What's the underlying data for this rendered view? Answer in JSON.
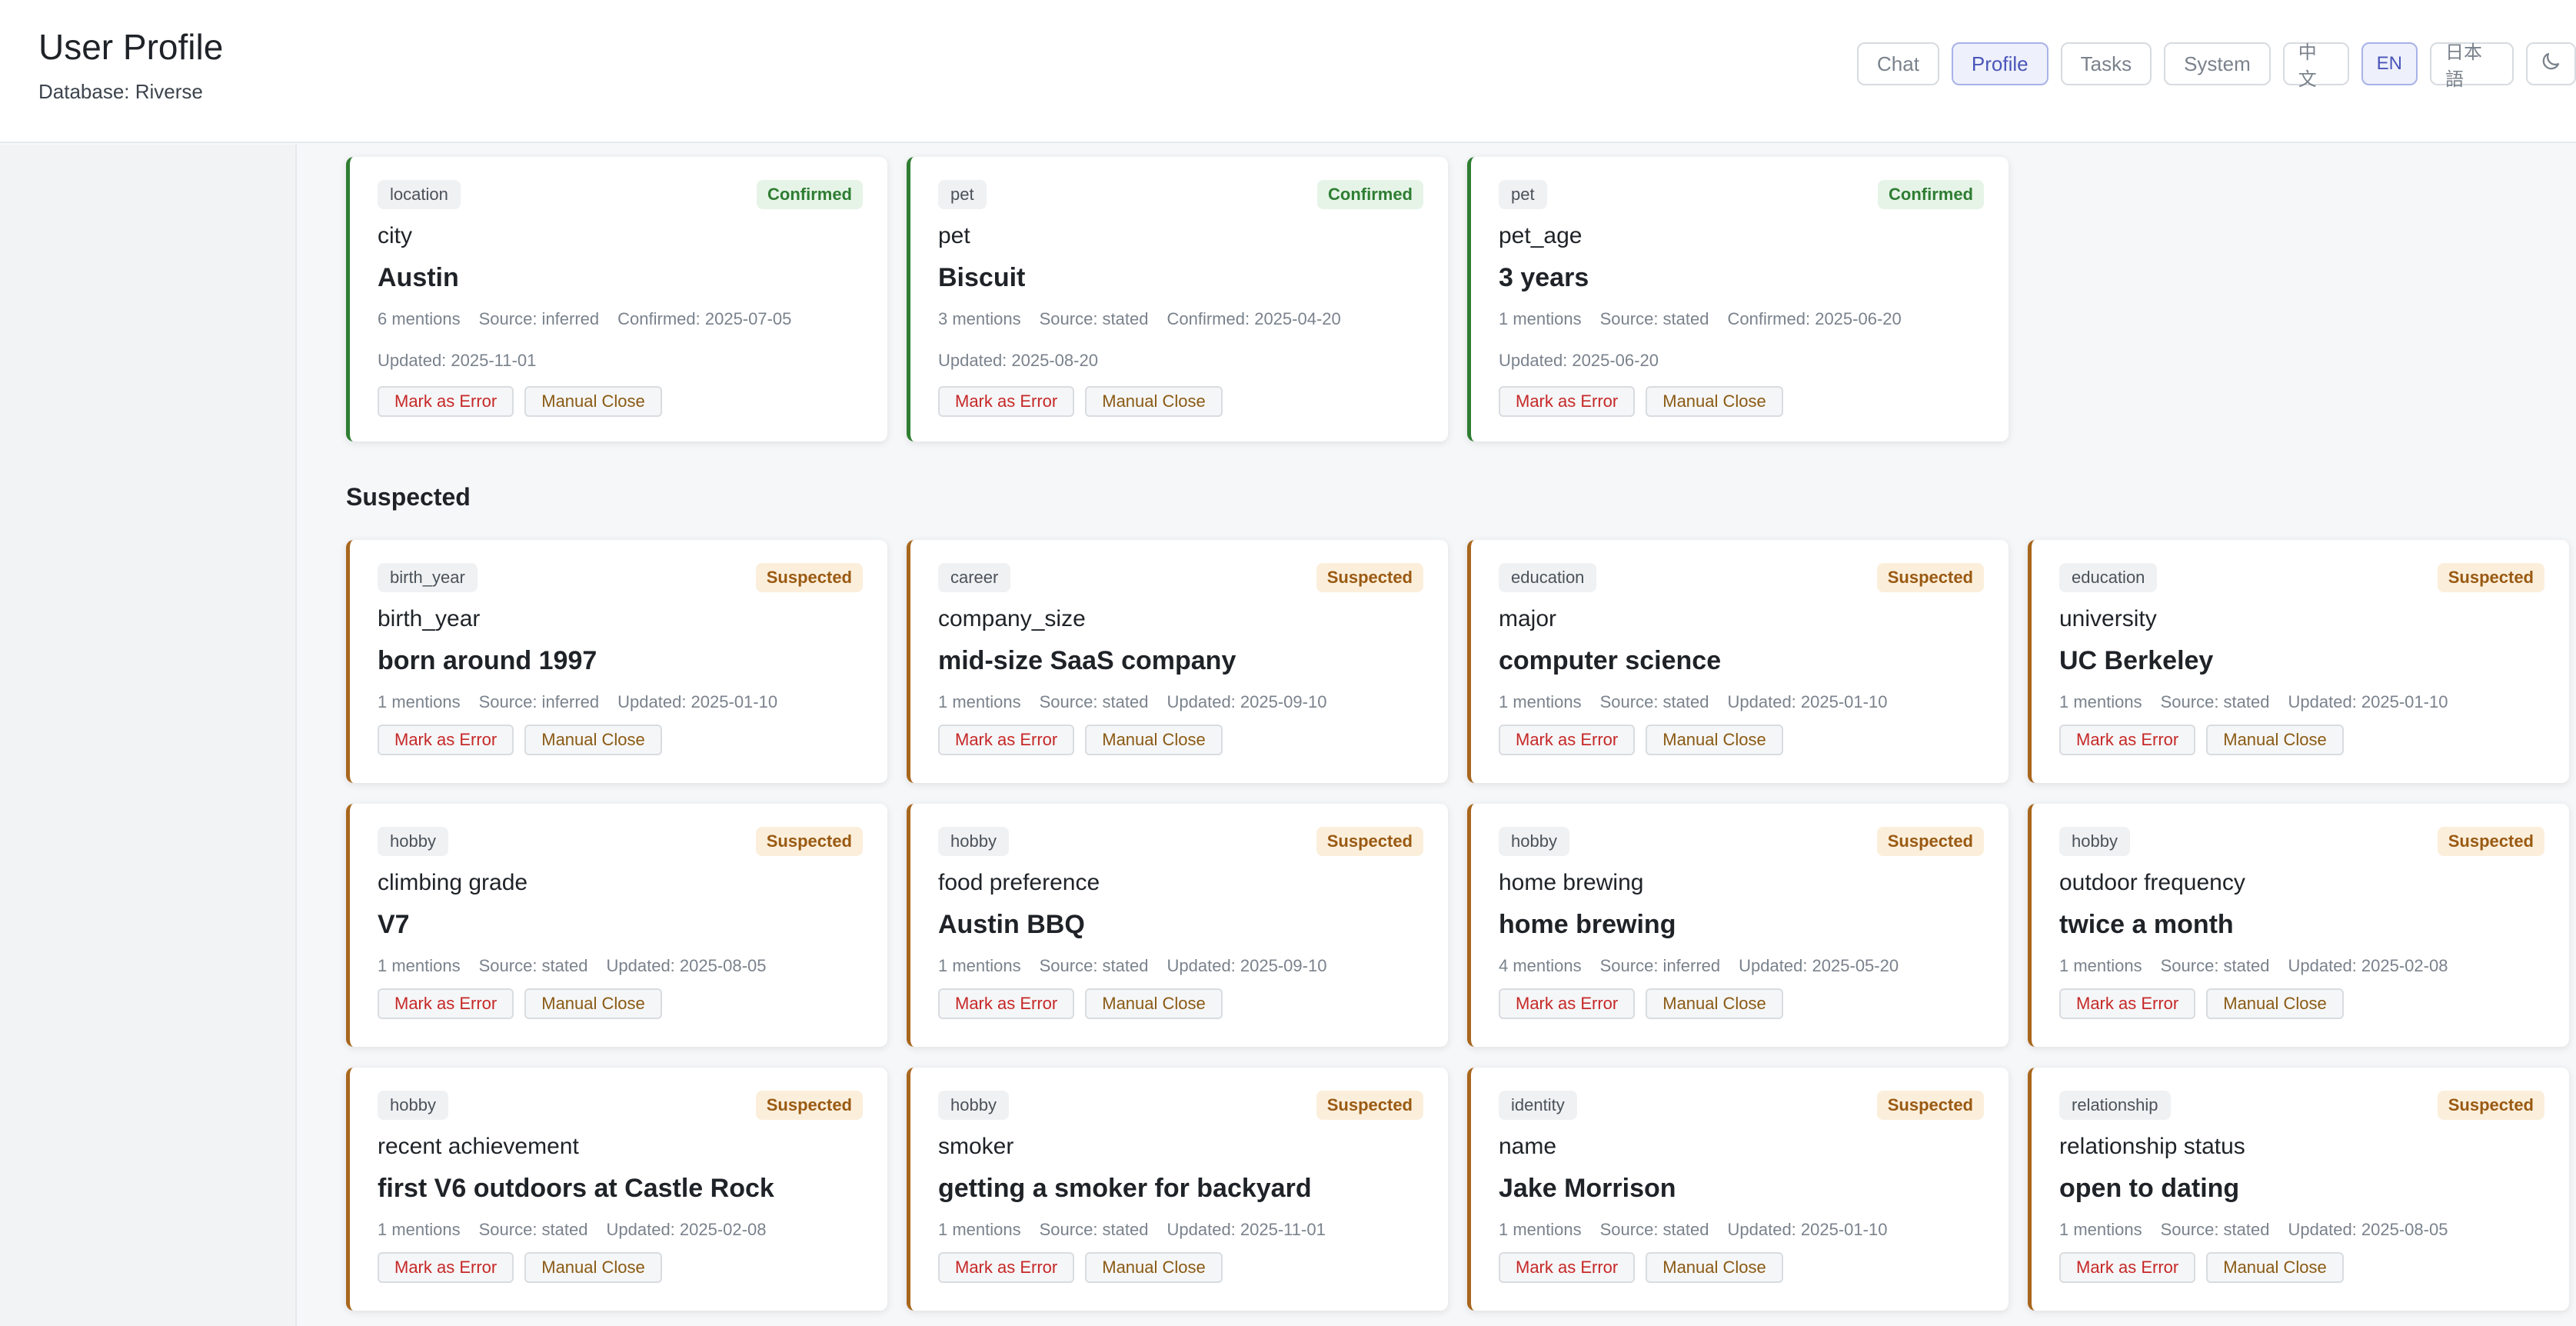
{
  "header": {
    "title": "User Profile",
    "subtitle": "Database: Riverse"
  },
  "nav": {
    "tabs": [
      "Chat",
      "Profile",
      "Tasks",
      "System"
    ],
    "active_tab": "Profile",
    "languages": [
      "中文",
      "EN",
      "日本語"
    ],
    "active_language": "EN",
    "theme_icon": "moon-icon"
  },
  "labels": {
    "mark_error": "Mark as Error",
    "manual_close": "Manual Close"
  },
  "confirmed": [
    {
      "category": "location",
      "status": "Confirmed",
      "key": "city",
      "value": "Austin",
      "mentions": "6 mentions",
      "source": "Source: inferred",
      "confirmed": "Confirmed: 2025-07-05",
      "updated": "Updated: 2025-11-01"
    },
    {
      "category": "pet",
      "status": "Confirmed",
      "key": "pet",
      "value": "Biscuit",
      "mentions": "3 mentions",
      "source": "Source: stated",
      "confirmed": "Confirmed: 2025-04-20",
      "updated": "Updated: 2025-08-20"
    },
    {
      "category": "pet",
      "status": "Confirmed",
      "key": "pet_age",
      "value": "3 years",
      "mentions": "1 mentions",
      "source": "Source: stated",
      "confirmed": "Confirmed: 2025-06-20",
      "updated": "Updated: 2025-06-20"
    }
  ],
  "suspected_title": "Suspected",
  "suspected": [
    {
      "category": "birth_year",
      "status": "Suspected",
      "key": "birth_year",
      "value": "born around 1997",
      "mentions": "1 mentions",
      "source": "Source: inferred",
      "updated": "Updated: 2025-01-10"
    },
    {
      "category": "career",
      "status": "Suspected",
      "key": "company_size",
      "value": "mid-size SaaS company",
      "mentions": "1 mentions",
      "source": "Source: stated",
      "updated": "Updated: 2025-09-10"
    },
    {
      "category": "education",
      "status": "Suspected",
      "key": "major",
      "value": "computer science",
      "mentions": "1 mentions",
      "source": "Source: stated",
      "updated": "Updated: 2025-01-10"
    },
    {
      "category": "education",
      "status": "Suspected",
      "key": "university",
      "value": "UC Berkeley",
      "mentions": "1 mentions",
      "source": "Source: stated",
      "updated": "Updated: 2025-01-10"
    },
    {
      "category": "hobby",
      "status": "Suspected",
      "key": "climbing grade",
      "value": "V7",
      "mentions": "1 mentions",
      "source": "Source: stated",
      "updated": "Updated: 2025-08-05"
    },
    {
      "category": "hobby",
      "status": "Suspected",
      "key": "food preference",
      "value": "Austin BBQ",
      "mentions": "1 mentions",
      "source": "Source: stated",
      "updated": "Updated: 2025-09-10"
    },
    {
      "category": "hobby",
      "status": "Suspected",
      "key": "home brewing",
      "value": "home brewing",
      "mentions": "4 mentions",
      "source": "Source: inferred",
      "updated": "Updated: 2025-05-20"
    },
    {
      "category": "hobby",
      "status": "Suspected",
      "key": "outdoor frequency",
      "value": "twice a month",
      "mentions": "1 mentions",
      "source": "Source: stated",
      "updated": "Updated: 2025-02-08"
    },
    {
      "category": "hobby",
      "status": "Suspected",
      "key": "recent achievement",
      "value": "first V6 outdoors at Castle Rock",
      "mentions": "1 mentions",
      "source": "Source: stated",
      "updated": "Updated: 2025-02-08"
    },
    {
      "category": "hobby",
      "status": "Suspected",
      "key": "smoker",
      "value": "getting a smoker for backyard",
      "mentions": "1 mentions",
      "source": "Source: stated",
      "updated": "Updated: 2025-11-01"
    },
    {
      "category": "identity",
      "status": "Suspected",
      "key": "name",
      "value": "Jake Morrison",
      "mentions": "1 mentions",
      "source": "Source: stated",
      "updated": "Updated: 2025-01-10"
    },
    {
      "category": "relationship",
      "status": "Suspected",
      "key": "relationship status",
      "value": "open to dating",
      "mentions": "1 mentions",
      "source": "Source: stated",
      "updated": "Updated: 2025-08-05"
    }
  ]
}
